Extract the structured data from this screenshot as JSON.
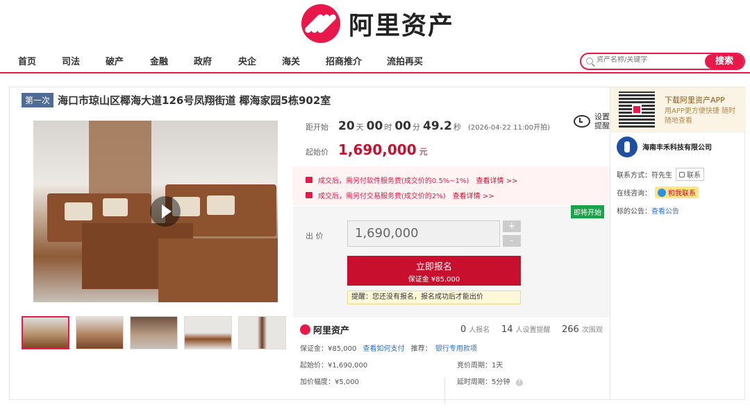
{
  "brand": {
    "name": "阿里资产"
  },
  "nav": {
    "items": [
      "首页",
      "司法",
      "破产",
      "金融",
      "政府",
      "央企",
      "海关",
      "招商推介",
      "流拍再买"
    ]
  },
  "search": {
    "placeholder": "资产名称/关键字",
    "button": "搜索"
  },
  "listing": {
    "round_badge": "第一次",
    "title": "海口市琼山区椰海大道126号凤翔街道 椰海家园5栋902室"
  },
  "countdown": {
    "label": "距开始",
    "days": "20",
    "days_unit": "天",
    "hours": "00",
    "hours_unit": "时",
    "minutes": "00",
    "minutes_unit": "分",
    "seconds": "49.2",
    "seconds_unit": "秒",
    "start_time": "(2026-04-22 11:00开拍)"
  },
  "remind": {
    "label": "设置提醒"
  },
  "start_price": {
    "label": "起始价",
    "value": "1,690,000",
    "unit": "元"
  },
  "notices": [
    {
      "text": "成交后，需另付软件服务费(成交价的0.5%~1%)",
      "link": "查看详情 >>"
    },
    {
      "text": "成交后，需另付交易服务费(成交价的2%)",
      "link": "查看详情 >>"
    }
  ],
  "bid": {
    "status_tag": "即将开始",
    "label": "出  价",
    "value": "1,690,000",
    "plus": "+",
    "minus": "-",
    "signup_label": "立即报名",
    "deposit_label": "保证金 ¥85,000",
    "tip": "提醒：您还没有报名，报名成功后才能出价"
  },
  "stats": {
    "brand": "阿里资产",
    "signups": "0",
    "signups_label": "人报名",
    "reminders": "14",
    "reminders_label": "人设置提醒",
    "views": "266",
    "views_label": "次围观"
  },
  "details": {
    "deposit": "保证金：¥85,000",
    "how_to_pay": "查看如何支付",
    "recommend": "推荐：",
    "bank_link": "银行专用款项",
    "start_price": "起始价：¥1,690,000",
    "period": "竞价周期：1天",
    "increment": "加价幅度：¥5,000",
    "extension": "延时周期：5分钟",
    "help": "?"
  },
  "side": {
    "app_title": "下载阿里资产APP",
    "app_sub": "用APP更方便快捷 随时随地查看",
    "company": "海南丰禾科技有限公司",
    "contact_label": "联系方式：符先生",
    "contact_btn": "联系",
    "consult_label": "在线咨询：",
    "chat_btn": "和我联系",
    "announcement_label": "标的公告：",
    "announcement_link": "查看公告"
  }
}
